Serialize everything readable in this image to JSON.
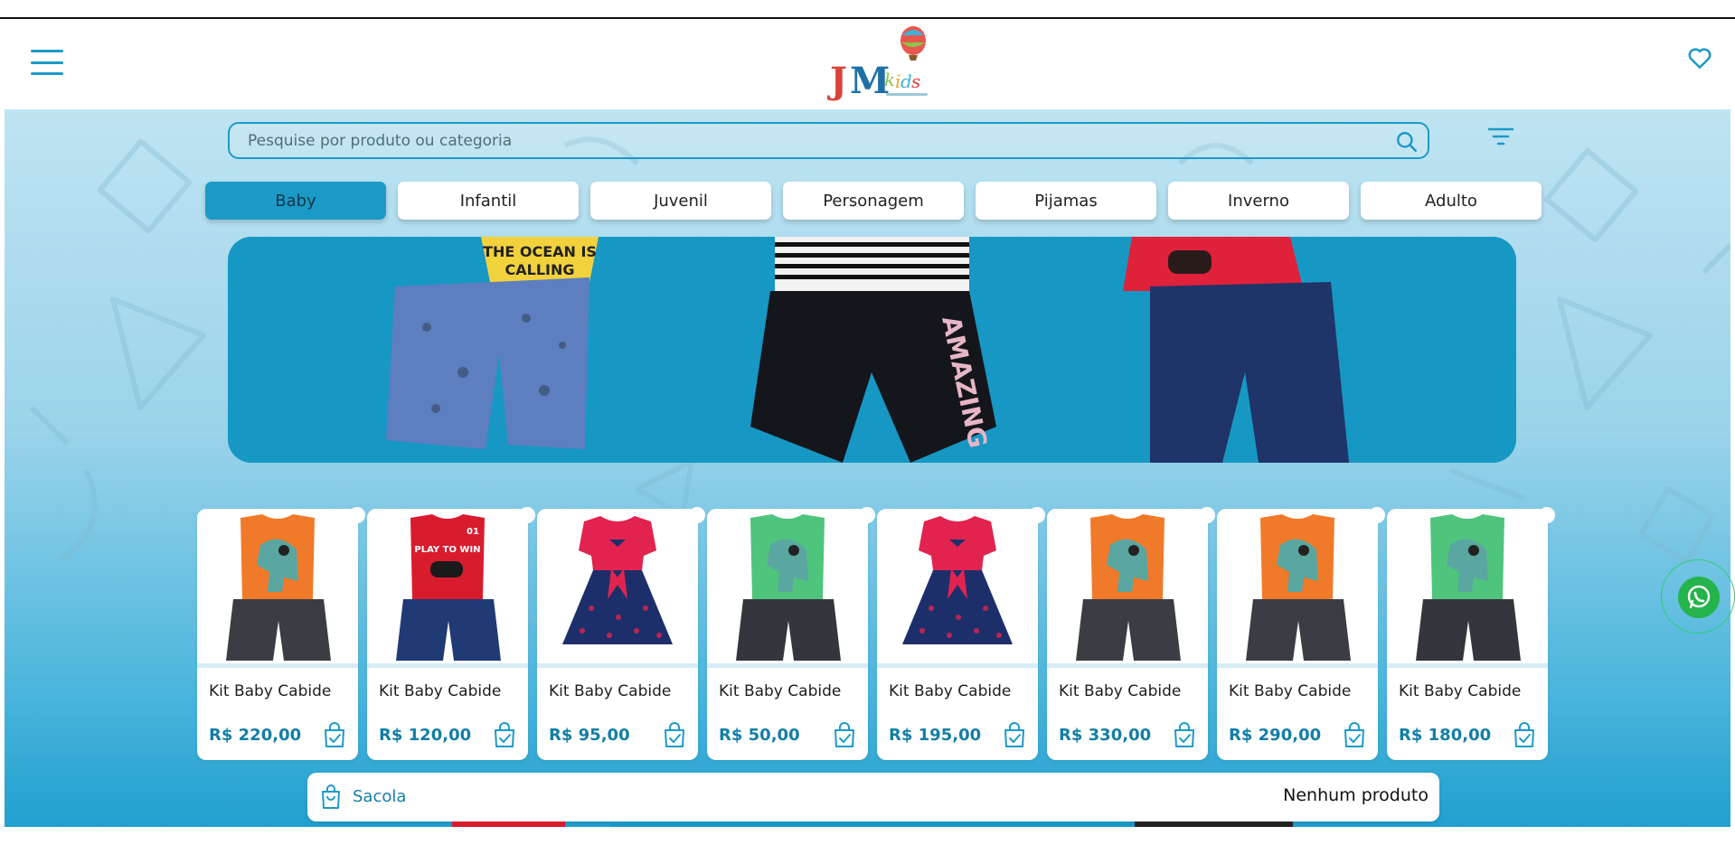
{
  "header": {
    "logo_alt": "JM Kids"
  },
  "search": {
    "placeholder": "Pesquise por produto ou categoria",
    "value": ""
  },
  "categories": [
    {
      "label": "Baby",
      "active": true
    },
    {
      "label": "Infantil",
      "active": false
    },
    {
      "label": "Juvenil",
      "active": false
    },
    {
      "label": "Personagem",
      "active": false
    },
    {
      "label": "Pijamas",
      "active": false
    },
    {
      "label": "Inverno",
      "active": false
    },
    {
      "label": "Adulto",
      "active": false
    }
  ],
  "banner": {
    "items": [
      {
        "shirt_color": "#f2d23c",
        "short_color": "#5d7fbf",
        "shirt_text": "THE OCEAN IS CALLING"
      },
      {
        "shirt_color": "#222222",
        "short_color": "#15151c",
        "shirt_text": "AMAZING"
      },
      {
        "shirt_color": "#e0213a",
        "short_color": "#1f3468",
        "shirt_text": ""
      }
    ]
  },
  "products": [
    {
      "title": "Kit Baby Cabide",
      "price": "R$ 220,00",
      "shirt_color": "#f07a2a",
      "short_color": "#3a3d44",
      "print": "dino"
    },
    {
      "title": "Kit Baby Cabide",
      "price": "R$ 120,00",
      "shirt_color": "#d81c2e",
      "short_color": "#1f3a75",
      "print": "PLAY TO WIN"
    },
    {
      "title": "Kit Baby Cabide",
      "price": "R$ 95,00",
      "shirt_color": "#e2234f",
      "short_color": "#1d2f6b",
      "print": "dress"
    },
    {
      "title": "Kit Baby Cabide",
      "price": "R$ 50,00",
      "shirt_color": "#4fc47d",
      "short_color": "#33363c",
      "print": "dino"
    },
    {
      "title": "Kit Baby Cabide",
      "price": "R$ 195,00",
      "shirt_color": "#e2234f",
      "short_color": "#1d2f6b",
      "print": "dress"
    },
    {
      "title": "Kit Baby Cabide",
      "price": "R$ 330,00",
      "shirt_color": "#f07a2a",
      "short_color": "#3a3d44",
      "print": "dino"
    },
    {
      "title": "Kit Baby Cabide",
      "price": "R$ 290,00",
      "shirt_color": "#f07a2a",
      "short_color": "#3a3d44",
      "print": "dino"
    },
    {
      "title": "Kit Baby Cabide",
      "price": "R$ 180,00",
      "shirt_color": "#4fc47d",
      "short_color": "#33363c",
      "print": "dino"
    }
  ],
  "bag": {
    "label": "Sacola",
    "status": "Nenhum produto"
  },
  "colors": {
    "accent": "#1c9ac7",
    "accent_dark": "#137ea6",
    "whatsapp": "#25b34b"
  },
  "icons": [
    "menu-icon",
    "heart-icon",
    "search-icon",
    "filter-icon",
    "bag-icon",
    "whatsapp-icon"
  ]
}
